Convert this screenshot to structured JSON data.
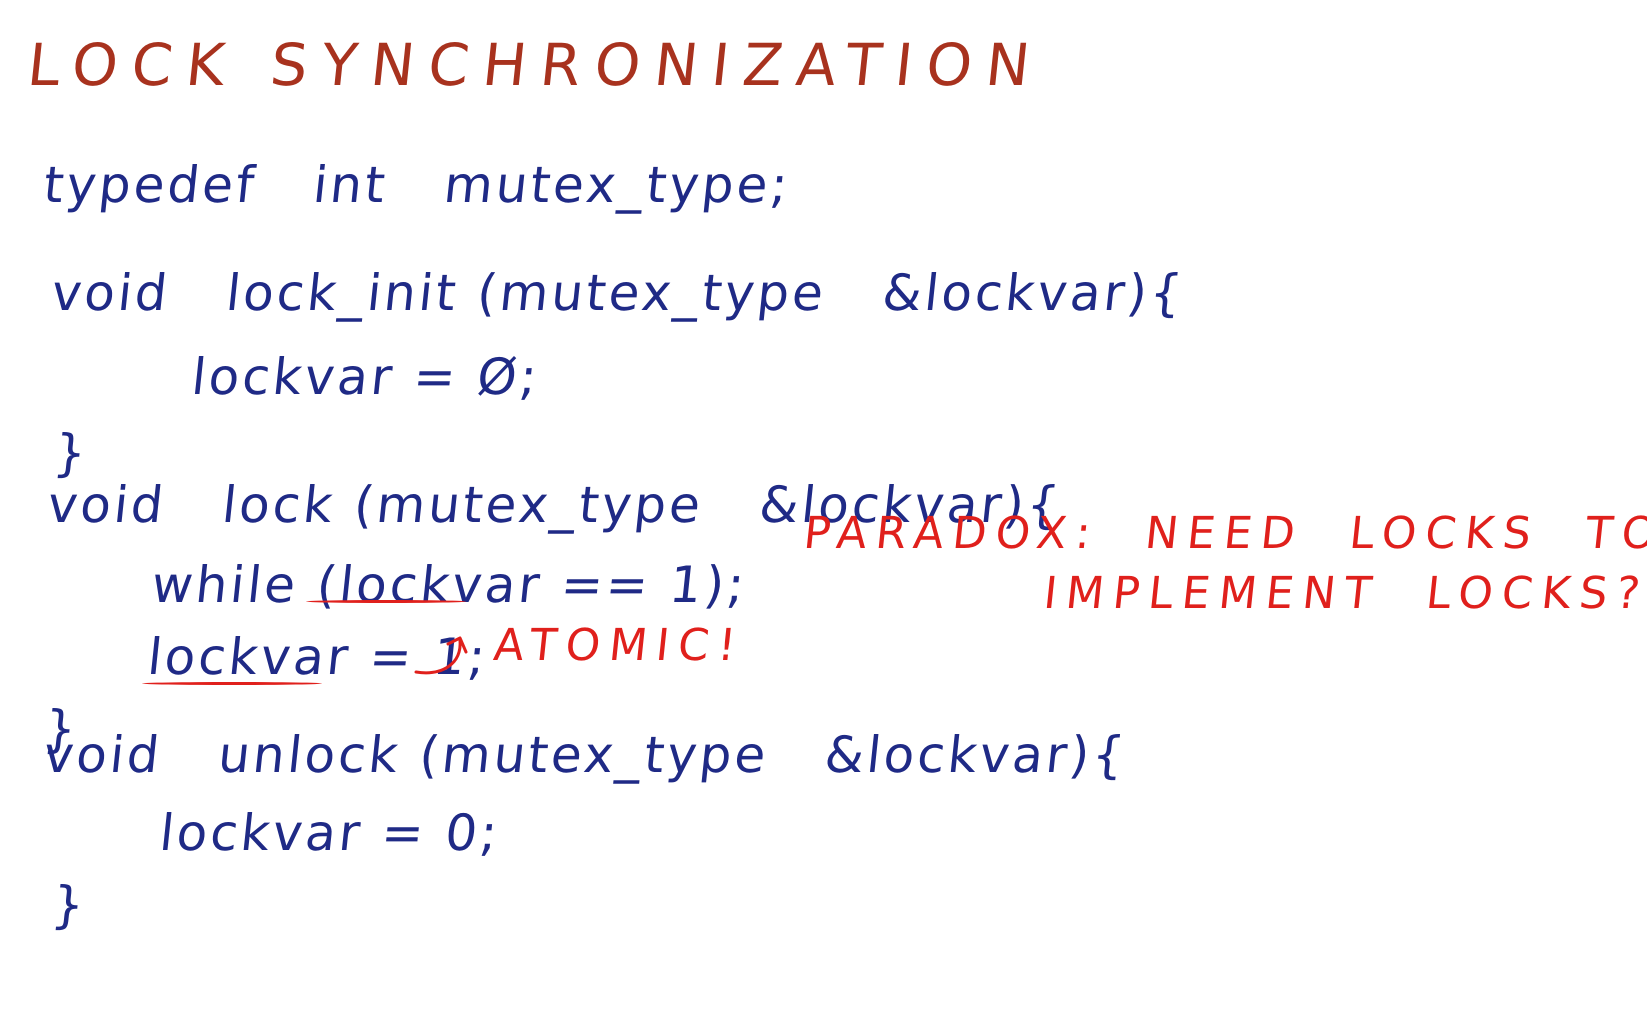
{
  "title": "LOCK SYNCHRONIZATION",
  "code_lines": {
    "typedef": "typedef   int   mutex_type;",
    "init_signature": "void   lock_init (mutex_type   &lockvar){",
    "init_body": "lockvar = Ø;",
    "init_close": "}",
    "lock_signature": "void   lock (mutex_type   &lockvar){",
    "lock_while": "while (lockvar == 1);",
    "lock_assign": "lockvar = 1;",
    "lock_close": "}",
    "unlock_signature": "void   unlock (mutex_type   &lockvar){",
    "unlock_body": "lockvar = 0;",
    "unlock_close": "}"
  },
  "annotations": {
    "atomic": "ATOMIC!",
    "paradox_line1": "PARADOX:  NEED  LOCKS  TO",
    "paradox_line2": "IMPLEMENT  LOCKS?"
  },
  "colors": {
    "title": "#a8321e",
    "code": "#1f2a86",
    "annotation": "#e0201c",
    "background": "#ffffff"
  }
}
